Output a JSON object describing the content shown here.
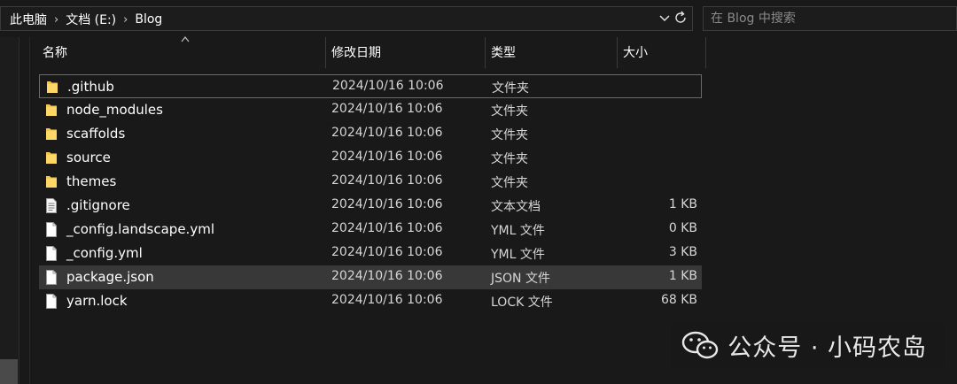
{
  "address": {
    "crumbs": [
      "此电脑",
      "文档 (E:)",
      "Blog"
    ]
  },
  "search": {
    "placeholder": "在 Blog 中搜索"
  },
  "columns": {
    "name": "名称",
    "date": "修改日期",
    "type": "类型",
    "size": "大小"
  },
  "files": [
    {
      "name": ".github",
      "date": "2024/10/16 10:06",
      "type": "文件夹",
      "size": "",
      "icon": "folder-icon"
    },
    {
      "name": "node_modules",
      "date": "2024/10/16 10:06",
      "type": "文件夹",
      "size": "",
      "icon": "folder-icon"
    },
    {
      "name": "scaffolds",
      "date": "2024/10/16 10:06",
      "type": "文件夹",
      "size": "",
      "icon": "folder-icon"
    },
    {
      "name": "source",
      "date": "2024/10/16 10:06",
      "type": "文件夹",
      "size": "",
      "icon": "folder-icon"
    },
    {
      "name": "themes",
      "date": "2024/10/16 10:06",
      "type": "文件夹",
      "size": "",
      "icon": "folder-icon"
    },
    {
      "name": ".gitignore",
      "date": "2024/10/16 10:06",
      "type": "文本文档",
      "size": "1 KB",
      "icon": "text-file-icon"
    },
    {
      "name": "_config.landscape.yml",
      "date": "2024/10/16 10:06",
      "type": "YML 文件",
      "size": "0 KB",
      "icon": "file-icon"
    },
    {
      "name": "_config.yml",
      "date": "2024/10/16 10:06",
      "type": "YML 文件",
      "size": "3 KB",
      "icon": "file-icon"
    },
    {
      "name": "package.json",
      "date": "2024/10/16 10:06",
      "type": "JSON 文件",
      "size": "1 KB",
      "icon": "file-icon"
    },
    {
      "name": "yarn.lock",
      "date": "2024/10/16 10:06",
      "type": "LOCK 文件",
      "size": "68 KB",
      "icon": "file-icon"
    }
  ],
  "watermark": {
    "text": "公众号 · 小码农岛"
  },
  "colors": {
    "background": "#191919",
    "folder": "#f3c74f",
    "selected_row": "#383838",
    "focus_border": "#6a6a6a"
  }
}
